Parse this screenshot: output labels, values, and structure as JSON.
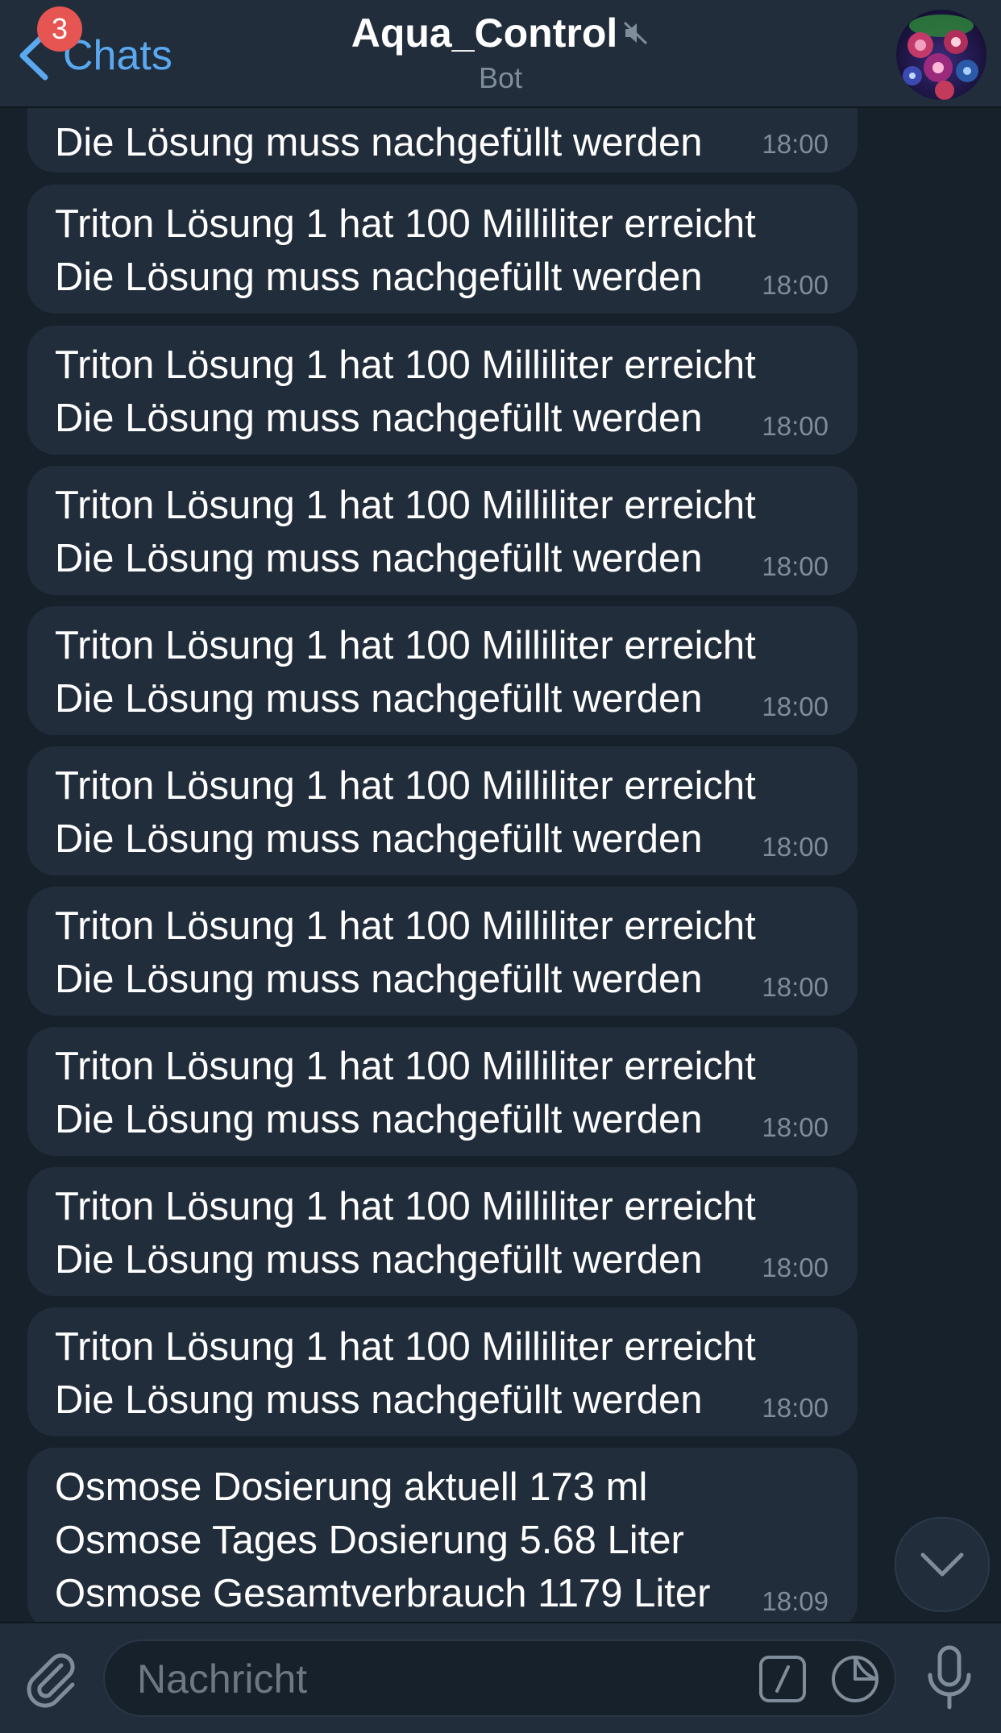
{
  "header": {
    "back_label": "Chats",
    "unread_count": "3",
    "title": "Aqua_Control",
    "subtitle": "Bot",
    "muted": true
  },
  "messages": [
    {
      "lines": [
        "Die Lösung muss nachgefüllt werden"
      ],
      "time": "18:00"
    },
    {
      "lines": [
        "Triton Lösung 1 hat 100 Milliliter erreicht",
        "Die Lösung muss nachgefüllt werden"
      ],
      "time": "18:00"
    },
    {
      "lines": [
        "Triton Lösung 1 hat 100 Milliliter erreicht",
        "Die Lösung muss nachgefüllt werden"
      ],
      "time": "18:00"
    },
    {
      "lines": [
        "Triton Lösung 1 hat 100 Milliliter erreicht",
        "Die Lösung muss nachgefüllt werden"
      ],
      "time": "18:00"
    },
    {
      "lines": [
        "Triton Lösung 1 hat 100 Milliliter erreicht",
        "Die Lösung muss nachgefüllt werden"
      ],
      "time": "18:00"
    },
    {
      "lines": [
        "Triton Lösung 1 hat 100 Milliliter erreicht",
        "Die Lösung muss nachgefüllt werden"
      ],
      "time": "18:00"
    },
    {
      "lines": [
        "Triton Lösung 1 hat 100 Milliliter erreicht",
        "Die Lösung muss nachgefüllt werden"
      ],
      "time": "18:00"
    },
    {
      "lines": [
        "Triton Lösung 1 hat 100 Milliliter erreicht",
        "Die Lösung muss nachgefüllt werden"
      ],
      "time": "18:00"
    },
    {
      "lines": [
        "Triton Lösung 1 hat 100 Milliliter erreicht",
        "Die Lösung muss nachgefüllt werden"
      ],
      "time": "18:00"
    },
    {
      "lines": [
        "Triton Lösung 1 hat 100 Milliliter erreicht",
        "Die Lösung muss nachgefüllt werden"
      ],
      "time": "18:00"
    },
    {
      "lines": [
        "Osmose Dosierung aktuell 173 ml",
        "Osmose Tages Dosierung 5.68 Liter",
        "Osmose Gesamtverbrauch 1179 Liter"
      ],
      "time": "18:09"
    }
  ],
  "input": {
    "placeholder": "Nachricht",
    "value": ""
  },
  "icons": {
    "back": "chevron-left-icon",
    "mute": "speaker-muted-icon",
    "attach": "paperclip-icon",
    "commands": "slash-command-icon",
    "sticker": "sticker-icon",
    "mic": "microphone-icon",
    "scroll": "chevron-down-icon"
  },
  "colors": {
    "background": "#17212b",
    "bubble": "#212d3b",
    "accent": "#5aa9f0",
    "badge": "#e65552",
    "muted_text": "#7f8c99"
  }
}
